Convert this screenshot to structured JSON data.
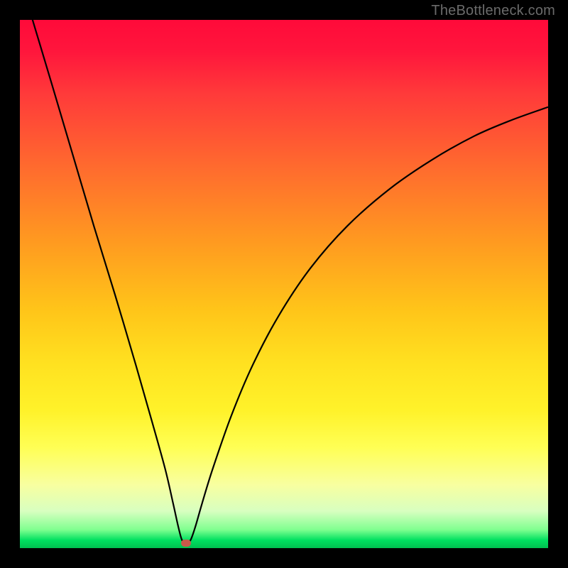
{
  "attribution": "TheBottleneck.com",
  "chart_data": {
    "type": "line",
    "title": "",
    "xlabel": "",
    "ylabel": "",
    "x_range": [
      0,
      100
    ],
    "y_range": [
      0,
      100
    ],
    "minimum_marker": {
      "x": 31.5,
      "y": 1.0,
      "color": "#c95a4a"
    },
    "series": [
      {
        "name": "bottleneck-curve",
        "color": "#000000",
        "points": [
          {
            "x": 0.0,
            "y": 108.0
          },
          {
            "x": 3.0,
            "y": 98.0
          },
          {
            "x": 6.0,
            "y": 88.0
          },
          {
            "x": 10.0,
            "y": 74.5
          },
          {
            "x": 14.0,
            "y": 61.0
          },
          {
            "x": 18.0,
            "y": 48.0
          },
          {
            "x": 22.0,
            "y": 34.5
          },
          {
            "x": 25.0,
            "y": 24.0
          },
          {
            "x": 27.5,
            "y": 15.0
          },
          {
            "x": 29.0,
            "y": 8.5
          },
          {
            "x": 30.0,
            "y": 4.0
          },
          {
            "x": 30.7,
            "y": 1.5
          },
          {
            "x": 31.5,
            "y": 1.0
          },
          {
            "x": 32.3,
            "y": 1.5
          },
          {
            "x": 33.2,
            "y": 4.0
          },
          {
            "x": 34.5,
            "y": 8.5
          },
          {
            "x": 36.5,
            "y": 15.0
          },
          {
            "x": 40.0,
            "y": 25.0
          },
          {
            "x": 44.0,
            "y": 34.5
          },
          {
            "x": 49.0,
            "y": 44.0
          },
          {
            "x": 55.0,
            "y": 53.0
          },
          {
            "x": 62.0,
            "y": 61.0
          },
          {
            "x": 70.0,
            "y": 68.0
          },
          {
            "x": 78.0,
            "y": 73.5
          },
          {
            "x": 86.0,
            "y": 78.0
          },
          {
            "x": 93.0,
            "y": 81.0
          },
          {
            "x": 100.0,
            "y": 83.5
          }
        ]
      }
    ],
    "background_gradient": {
      "stops": [
        {
          "pos": 0.0,
          "color": "#ff0a3a"
        },
        {
          "pos": 0.5,
          "color": "#ffc519"
        },
        {
          "pos": 0.82,
          "color": "#ffff55"
        },
        {
          "pos": 0.97,
          "color": "#80ff90"
        },
        {
          "pos": 1.0,
          "color": "#00c050"
        }
      ]
    }
  }
}
